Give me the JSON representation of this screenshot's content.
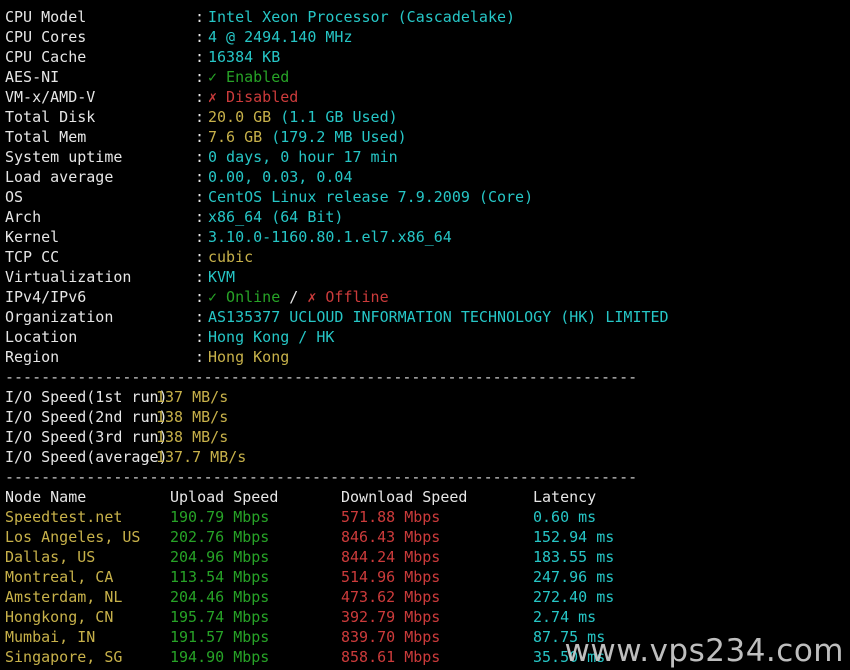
{
  "terminal": {
    "separator": "----------------------------------------------------------------------",
    "colon": ":",
    "watermark": "www.vps234.com"
  },
  "system_info": [
    {
      "label": "CPU Model",
      "value": "Intel Xeon Processor (Cascadelake)",
      "color": "c-cyan"
    },
    {
      "label": "CPU Cores",
      "value": "4 @ 2494.140 MHz",
      "color": "c-cyan"
    },
    {
      "label": "CPU Cache",
      "value": "16384 KB",
      "color": "c-cyan"
    },
    {
      "label": "AES-NI",
      "value": "✓ Enabled",
      "color": "c-green"
    },
    {
      "label": "VM-x/AMD-V",
      "value": "✗ Disabled",
      "color": "c-red"
    },
    {
      "label": "Total Disk",
      "value": "20.0 GB (1.1 GB Used)",
      "color": "c-yellow",
      "segments": [
        {
          "text": "20.0 GB ",
          "color": "c-yellow"
        },
        {
          "text": "(1.1 GB Used)",
          "color": "c-cyan"
        }
      ]
    },
    {
      "label": "Total Mem",
      "value": "7.6 GB (179.2 MB Used)",
      "color": "c-yellow",
      "segments": [
        {
          "text": "7.6 GB ",
          "color": "c-yellow"
        },
        {
          "text": "(179.2 MB Used)",
          "color": "c-cyan"
        }
      ]
    },
    {
      "label": "System uptime",
      "value": "0 days, 0 hour 17 min",
      "color": "c-cyan"
    },
    {
      "label": "Load average",
      "value": "0.00, 0.03, 0.04",
      "color": "c-cyan"
    },
    {
      "label": "OS",
      "value": "CentOS Linux release 7.9.2009 (Core)",
      "color": "c-cyan"
    },
    {
      "label": "Arch",
      "value": "x86_64 (64 Bit)",
      "color": "c-cyan"
    },
    {
      "label": "Kernel",
      "value": "3.10.0-1160.80.1.el7.x86_64",
      "color": "c-cyan"
    },
    {
      "label": "TCP CC",
      "value": "cubic",
      "color": "c-yellow"
    },
    {
      "label": "Virtualization",
      "value": "KVM",
      "color": "c-cyan"
    },
    {
      "label": "IPv4/IPv6",
      "value": "✓ Online / ✗ Offline",
      "color": "c-green",
      "segments": [
        {
          "text": "✓ Online ",
          "color": "c-green"
        },
        {
          "text": "/ ",
          "color": "c-white"
        },
        {
          "text": "✗ Offline",
          "color": "c-red"
        }
      ]
    },
    {
      "label": "Organization",
      "value": "AS135377 UCLOUD INFORMATION TECHNOLOGY (HK) LIMITED",
      "color": "c-cyan"
    },
    {
      "label": "Location",
      "value": "Hong Kong / HK",
      "color": "c-cyan"
    },
    {
      "label": "Region",
      "value": "Hong Kong",
      "color": "c-yellow"
    }
  ],
  "io_speed": {
    "rows": [
      {
        "label": "I/O Speed(1st run)",
        "value": "137 MB/s"
      },
      {
        "label": "I/O Speed(2nd run)",
        "value": "138 MB/s"
      },
      {
        "label": "I/O Speed(3rd run)",
        "value": "138 MB/s"
      },
      {
        "label": "I/O Speed(average)",
        "value": "137.7 MB/s"
      }
    ]
  },
  "speedtest": {
    "headers": {
      "node": "Node Name",
      "upload": "Upload Speed",
      "download": "Download Speed",
      "latency": "Latency"
    },
    "rows": [
      {
        "node": "Speedtest.net",
        "upload": "190.79 Mbps",
        "download": "571.88 Mbps",
        "latency": "0.60 ms"
      },
      {
        "node": "Los Angeles, US",
        "upload": "202.76 Mbps",
        "download": "846.43 Mbps",
        "latency": "152.94 ms"
      },
      {
        "node": "Dallas, US",
        "upload": "204.96 Mbps",
        "download": "844.24 Mbps",
        "latency": "183.55 ms"
      },
      {
        "node": "Montreal, CA",
        "upload": "113.54 Mbps",
        "download": "514.96 Mbps",
        "latency": "247.96 ms"
      },
      {
        "node": "Amsterdam, NL",
        "upload": "204.46 Mbps",
        "download": "473.62 Mbps",
        "latency": "272.40 ms"
      },
      {
        "node": "Hongkong, CN",
        "upload": "195.74 Mbps",
        "download": "392.79 Mbps",
        "latency": "2.74 ms"
      },
      {
        "node": "Mumbai, IN",
        "upload": "191.57 Mbps",
        "download": "839.70 Mbps",
        "latency": "87.75 ms"
      },
      {
        "node": "Singapore, SG",
        "upload": "194.90 Mbps",
        "download": "858.61 Mbps",
        "latency": "35.50 ms"
      }
    ]
  },
  "colors": {
    "background": "#000000",
    "cyan": "#26c6c6",
    "yellow": "#c7b14a",
    "green": "#27a327",
    "red": "#cc3b3b",
    "white": "#e6e6e6"
  }
}
